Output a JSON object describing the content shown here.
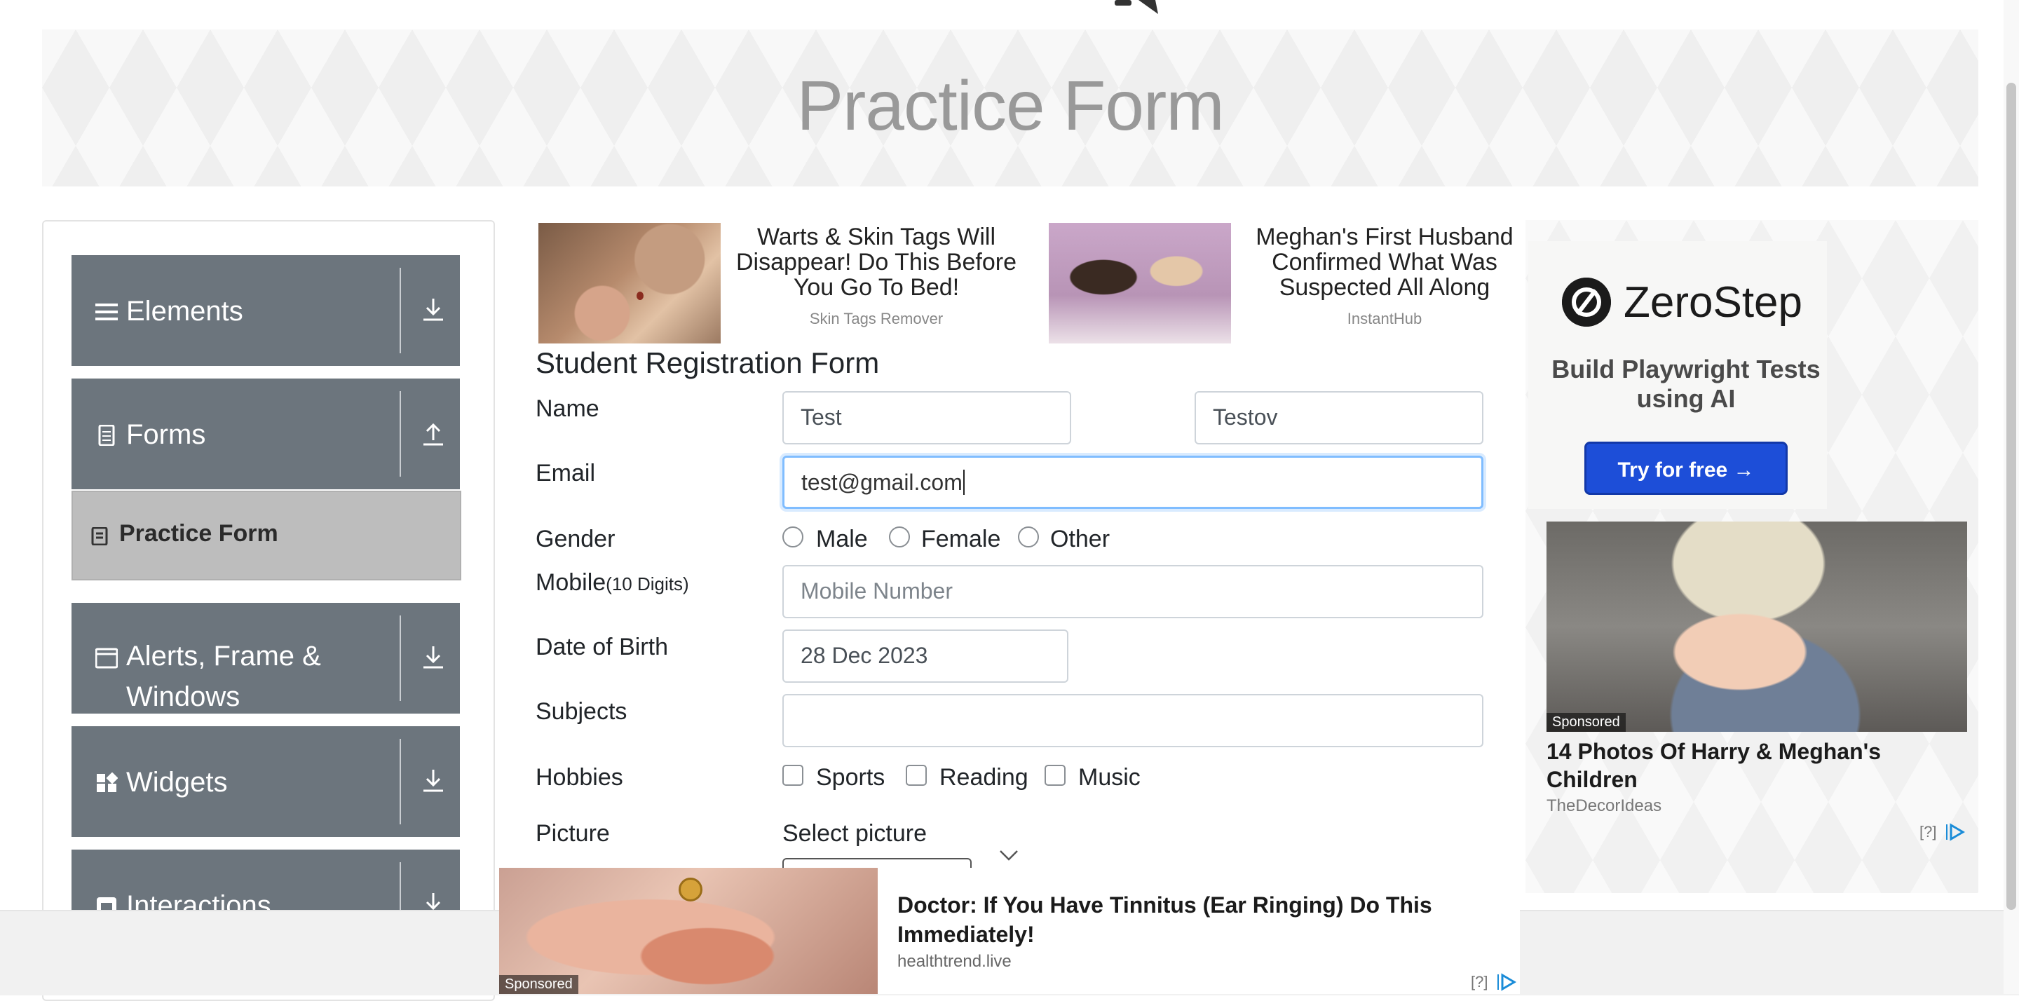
{
  "header": {
    "title": "Practice Form"
  },
  "sidebar": {
    "groups": [
      {
        "label": "Elements",
        "icon": "menu-icon",
        "arrow": "download-icon"
      },
      {
        "label": "Forms",
        "icon": "document-icon",
        "arrow": "upload-icon"
      },
      {
        "label_line1": "Alerts, Frame &",
        "label_line2": "Windows",
        "icon": "window-icon",
        "arrow": "download-icon"
      },
      {
        "label": "Widgets",
        "icon": "widgets-icon",
        "arrow": "download-icon"
      },
      {
        "label": "Interactions",
        "icon": "interactions-icon",
        "arrow": "download-icon"
      }
    ],
    "active_item": {
      "label": "Practice Form",
      "icon": "form-icon"
    }
  },
  "top_ads": [
    {
      "text": "Warts & Skin Tags Will Disappear! Do This Before You Go To Bed!",
      "source": "Skin Tags Remover"
    },
    {
      "text": "Meghan's First Husband Confirmed What Was Suspected All Along",
      "source": "InstantHub"
    }
  ],
  "form": {
    "title": "Student Registration Form",
    "name_label": "Name",
    "first_name": "Test",
    "last_name": "Testov",
    "email_label": "Email",
    "email_value": "test@gmail.com",
    "gender_label": "Gender",
    "gender_options": [
      "Male",
      "Female",
      "Other"
    ],
    "mobile_label": "Mobile",
    "mobile_hint": "(10 Digits)",
    "mobile_placeholder": "Mobile Number",
    "dob_label": "Date of Birth",
    "dob_value": "28 Dec 2023",
    "subjects_label": "Subjects",
    "subjects_value": "",
    "hobbies_label": "Hobbies",
    "hobbies_options": [
      "Sports",
      "Reading",
      "Music"
    ],
    "picture_label": "Picture",
    "picture_prompt": "Select picture"
  },
  "right_ad": {
    "brand": "ZeroStep",
    "tagline": "Build Playwright Tests using AI",
    "cta": "Try for free →",
    "sponsored": "Sponsored",
    "story_title": "14 Photos Of Harry & Meghan's Children",
    "story_source": "TheDecorIdeas",
    "adchoice": "[?]"
  },
  "bottom_ad": {
    "sponsored": "Sponsored",
    "title": "Doctor: If You Have Tinnitus (Ear Ringing) Do This Immediately!",
    "source": "healthtrend.live",
    "adchoice": "[?]"
  },
  "colors": {
    "sidebar_group": "#6c757d",
    "active_item": "#bdbdbd",
    "focus_border": "#80bdff",
    "cta_button": "#1d4ed8",
    "banner_title": "#999999"
  }
}
